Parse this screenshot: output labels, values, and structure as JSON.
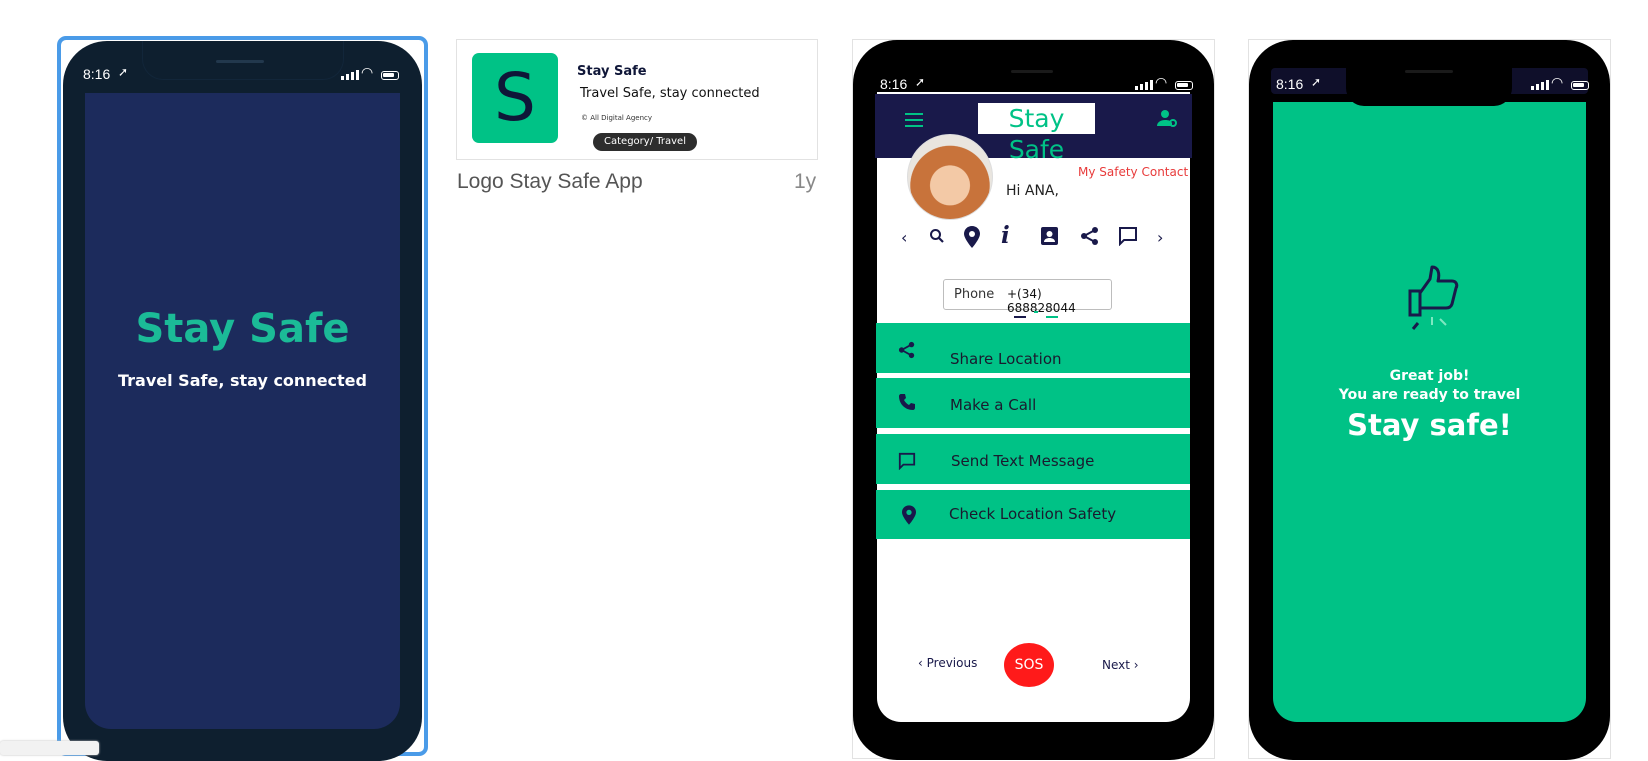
{
  "screen1": {
    "time": "8:16",
    "title": "Stay Safe",
    "tagline": "Travel Safe, stay connected",
    "colors": {
      "bg": "#1c2b5c",
      "frame": "#0e1f2f",
      "title": "#1bbb97"
    }
  },
  "logo_card": {
    "app_name": "Stay Safe",
    "tagline": "Travel Safe, stay connected",
    "copyright": "© All Digital Agency",
    "category": "Category/ Travel",
    "logo_letter": "S",
    "caption": "Logo Stay Safe App",
    "age": "1y",
    "colors": {
      "logo_bg": "#00c286",
      "logo_letter": "#0f1638"
    }
  },
  "screen3": {
    "time": "8:16",
    "header_title": "Stay Safe",
    "safety_contact": "My Safety Contact",
    "greeting": "Hi ANA,",
    "phone_label": "Phone",
    "phone_value": "+(34) 688828044",
    "actions": [
      {
        "label": "Share Location",
        "icon": "share-icon"
      },
      {
        "label": "Make a Call",
        "icon": "phone-icon"
      },
      {
        "label": "Send Text Message",
        "icon": "message-icon"
      },
      {
        "label": "Check Location Safety",
        "icon": "location-pin-icon"
      }
    ],
    "previous": "Previous",
    "sos": "SOS",
    "next": "Next",
    "colors": {
      "header": "#19194a",
      "accent": "#00c286",
      "sos": "#ff1a1a",
      "contact": "#e83b3b"
    }
  },
  "screen4": {
    "time": "8:16",
    "line1": "Great job!",
    "line2": "You are ready to travel",
    "line3": "Stay safe!",
    "colors": {
      "bg": "#00c286"
    }
  }
}
